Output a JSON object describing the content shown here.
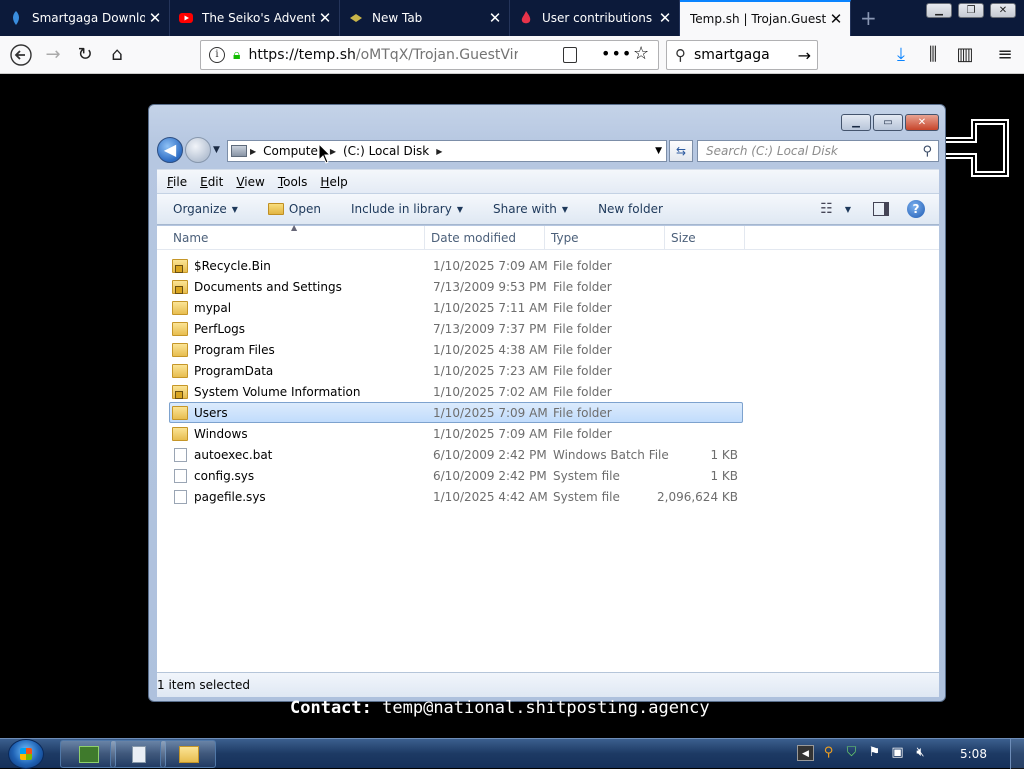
{
  "browser": {
    "tabs": [
      {
        "label": "Smartgaga Download",
        "icon": "smartgaga-icon",
        "active": false
      },
      {
        "label": "The Seiko's Adventur",
        "icon": "youtube-icon",
        "active": false
      },
      {
        "label": "New Tab",
        "icon": "newtab-icon",
        "active": false
      },
      {
        "label": "User contributions fo",
        "icon": "fire-icon",
        "active": false
      },
      {
        "label": "Temp.sh | Trojan.GuestV",
        "icon": "",
        "active": true
      }
    ],
    "url_main": "https://temp.sh",
    "url_rest": "/oMTqX/Trojan.GuestVirus.ex",
    "search_value": "smartgaga",
    "colors": {
      "tabstrip": "#0c1a3a",
      "accent": "#0a84ff",
      "lock": "#12bc00"
    }
  },
  "explorer": {
    "breadcrumb": [
      "Computer",
      "(C:) Local Disk"
    ],
    "search_placeholder": "Search (C:) Local Disk",
    "menu": [
      {
        "key": "F",
        "rest": "ile"
      },
      {
        "key": "E",
        "rest": "dit"
      },
      {
        "key": "V",
        "rest": "iew"
      },
      {
        "key": "T",
        "rest": "ools"
      },
      {
        "key": "H",
        "rest": "elp"
      }
    ],
    "commands": {
      "organize": "Organize",
      "open": "Open",
      "include": "Include in library",
      "share": "Share with",
      "newfolder": "New folder"
    },
    "columns": {
      "name": "Name",
      "date": "Date modified",
      "type": "Type",
      "size": "Size"
    },
    "files": [
      {
        "name": "$Recycle.Bin",
        "date": "1/10/2025 7:09 AM",
        "type": "File folder",
        "size": "",
        "icon": "locked-folder"
      },
      {
        "name": "Documents and Settings",
        "date": "7/13/2009 9:53 PM",
        "type": "File folder",
        "size": "",
        "icon": "locked-folder"
      },
      {
        "name": "mypal",
        "date": "1/10/2025 7:11 AM",
        "type": "File folder",
        "size": "",
        "icon": "folder"
      },
      {
        "name": "PerfLogs",
        "date": "7/13/2009 7:37 PM",
        "type": "File folder",
        "size": "",
        "icon": "folder"
      },
      {
        "name": "Program Files",
        "date": "1/10/2025 4:38 AM",
        "type": "File folder",
        "size": "",
        "icon": "folder"
      },
      {
        "name": "ProgramData",
        "date": "1/10/2025 7:23 AM",
        "type": "File folder",
        "size": "",
        "icon": "folder"
      },
      {
        "name": "System Volume Information",
        "date": "1/10/2025 7:02 AM",
        "type": "File folder",
        "size": "",
        "icon": "locked-folder"
      },
      {
        "name": "Users",
        "date": "1/10/2025 7:09 AM",
        "type": "File folder",
        "size": "",
        "icon": "folder",
        "selected": true
      },
      {
        "name": "Windows",
        "date": "1/10/2025 7:09 AM",
        "type": "File folder",
        "size": "",
        "icon": "folder"
      },
      {
        "name": "autoexec.bat",
        "date": "6/10/2009 2:42 PM",
        "type": "Windows Batch File",
        "size": "1 KB",
        "icon": "file"
      },
      {
        "name": "config.sys",
        "date": "6/10/2009 2:42 PM",
        "type": "System file",
        "size": "1 KB",
        "icon": "file"
      },
      {
        "name": "pagefile.sys",
        "date": "1/10/2025 4:42 AM",
        "type": "System file",
        "size": "2,096,624 KB",
        "icon": "file"
      }
    ],
    "status": "1 item selected"
  },
  "overlay": {
    "contact_label": "Contact:",
    "contact_email": "temp@national.shitposting.agency"
  },
  "taskbar": {
    "clock": "5:08"
  }
}
